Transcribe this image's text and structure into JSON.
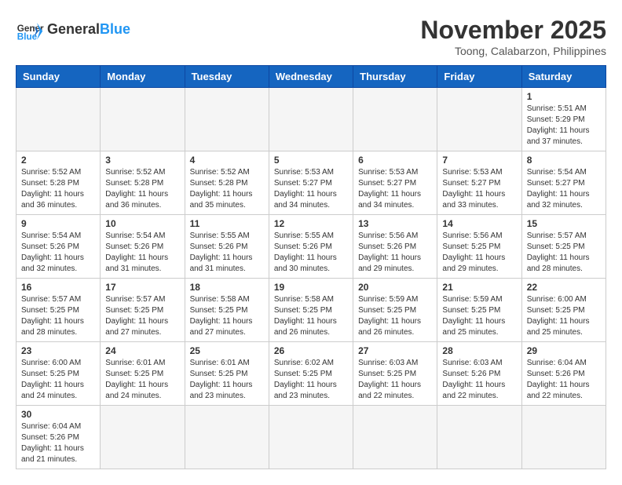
{
  "header": {
    "logo_general": "General",
    "logo_blue": "Blue",
    "month_title": "November 2025",
    "location": "Toong, Calabarzon, Philippines"
  },
  "weekdays": [
    "Sunday",
    "Monday",
    "Tuesday",
    "Wednesday",
    "Thursday",
    "Friday",
    "Saturday"
  ],
  "weeks": [
    [
      {
        "day": "",
        "empty": true
      },
      {
        "day": "",
        "empty": true
      },
      {
        "day": "",
        "empty": true
      },
      {
        "day": "",
        "empty": true
      },
      {
        "day": "",
        "empty": true
      },
      {
        "day": "",
        "empty": true
      },
      {
        "day": "1",
        "sunrise": "5:51 AM",
        "sunset": "5:29 PM",
        "daylight": "11 hours and 37 minutes."
      }
    ],
    [
      {
        "day": "2",
        "sunrise": "5:52 AM",
        "sunset": "5:28 PM",
        "daylight": "11 hours and 36 minutes."
      },
      {
        "day": "3",
        "sunrise": "5:52 AM",
        "sunset": "5:28 PM",
        "daylight": "11 hours and 36 minutes."
      },
      {
        "day": "4",
        "sunrise": "5:52 AM",
        "sunset": "5:28 PM",
        "daylight": "11 hours and 35 minutes."
      },
      {
        "day": "5",
        "sunrise": "5:53 AM",
        "sunset": "5:27 PM",
        "daylight": "11 hours and 34 minutes."
      },
      {
        "day": "6",
        "sunrise": "5:53 AM",
        "sunset": "5:27 PM",
        "daylight": "11 hours and 34 minutes."
      },
      {
        "day": "7",
        "sunrise": "5:53 AM",
        "sunset": "5:27 PM",
        "daylight": "11 hours and 33 minutes."
      },
      {
        "day": "8",
        "sunrise": "5:54 AM",
        "sunset": "5:27 PM",
        "daylight": "11 hours and 32 minutes."
      }
    ],
    [
      {
        "day": "9",
        "sunrise": "5:54 AM",
        "sunset": "5:26 PM",
        "daylight": "11 hours and 32 minutes."
      },
      {
        "day": "10",
        "sunrise": "5:54 AM",
        "sunset": "5:26 PM",
        "daylight": "11 hours and 31 minutes."
      },
      {
        "day": "11",
        "sunrise": "5:55 AM",
        "sunset": "5:26 PM",
        "daylight": "11 hours and 31 minutes."
      },
      {
        "day": "12",
        "sunrise": "5:55 AM",
        "sunset": "5:26 PM",
        "daylight": "11 hours and 30 minutes."
      },
      {
        "day": "13",
        "sunrise": "5:56 AM",
        "sunset": "5:26 PM",
        "daylight": "11 hours and 29 minutes."
      },
      {
        "day": "14",
        "sunrise": "5:56 AM",
        "sunset": "5:25 PM",
        "daylight": "11 hours and 29 minutes."
      },
      {
        "day": "15",
        "sunrise": "5:57 AM",
        "sunset": "5:25 PM",
        "daylight": "11 hours and 28 minutes."
      }
    ],
    [
      {
        "day": "16",
        "sunrise": "5:57 AM",
        "sunset": "5:25 PM",
        "daylight": "11 hours and 28 minutes."
      },
      {
        "day": "17",
        "sunrise": "5:57 AM",
        "sunset": "5:25 PM",
        "daylight": "11 hours and 27 minutes."
      },
      {
        "day": "18",
        "sunrise": "5:58 AM",
        "sunset": "5:25 PM",
        "daylight": "11 hours and 27 minutes."
      },
      {
        "day": "19",
        "sunrise": "5:58 AM",
        "sunset": "5:25 PM",
        "daylight": "11 hours and 26 minutes."
      },
      {
        "day": "20",
        "sunrise": "5:59 AM",
        "sunset": "5:25 PM",
        "daylight": "11 hours and 26 minutes."
      },
      {
        "day": "21",
        "sunrise": "5:59 AM",
        "sunset": "5:25 PM",
        "daylight": "11 hours and 25 minutes."
      },
      {
        "day": "22",
        "sunrise": "6:00 AM",
        "sunset": "5:25 PM",
        "daylight": "11 hours and 25 minutes."
      }
    ],
    [
      {
        "day": "23",
        "sunrise": "6:00 AM",
        "sunset": "5:25 PM",
        "daylight": "11 hours and 24 minutes."
      },
      {
        "day": "24",
        "sunrise": "6:01 AM",
        "sunset": "5:25 PM",
        "daylight": "11 hours and 24 minutes."
      },
      {
        "day": "25",
        "sunrise": "6:01 AM",
        "sunset": "5:25 PM",
        "daylight": "11 hours and 23 minutes."
      },
      {
        "day": "26",
        "sunrise": "6:02 AM",
        "sunset": "5:25 PM",
        "daylight": "11 hours and 23 minutes."
      },
      {
        "day": "27",
        "sunrise": "6:03 AM",
        "sunset": "5:25 PM",
        "daylight": "11 hours and 22 minutes."
      },
      {
        "day": "28",
        "sunrise": "6:03 AM",
        "sunset": "5:26 PM",
        "daylight": "11 hours and 22 minutes."
      },
      {
        "day": "29",
        "sunrise": "6:04 AM",
        "sunset": "5:26 PM",
        "daylight": "11 hours and 22 minutes."
      }
    ],
    [
      {
        "day": "30",
        "sunrise": "6:04 AM",
        "sunset": "5:26 PM",
        "daylight": "11 hours and 21 minutes."
      },
      {
        "day": "",
        "empty": true
      },
      {
        "day": "",
        "empty": true
      },
      {
        "day": "",
        "empty": true
      },
      {
        "day": "",
        "empty": true
      },
      {
        "day": "",
        "empty": true
      },
      {
        "day": "",
        "empty": true
      }
    ]
  ]
}
